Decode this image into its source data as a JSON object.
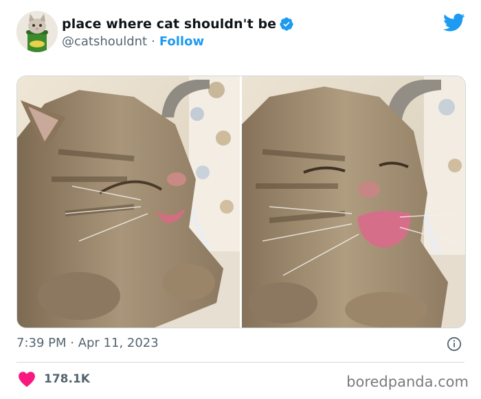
{
  "tweet": {
    "display_name": "place where cat shouldn't be",
    "handle": "@catshouldnt",
    "separator": "·",
    "follow_label": "Follow",
    "timestamp": "7:39 PM · Apr 11, 2023",
    "like_count": "178.1K"
  },
  "watermark": "boredpanda.com",
  "icons": {
    "verified": "verified-badge-icon",
    "platform": "twitter-bird-icon",
    "info": "info-icon",
    "like": "heart-icon"
  },
  "colors": {
    "accent": "#1d9bf0",
    "heart": "#f91880",
    "text_primary": "#0f1419",
    "text_secondary": "#536471",
    "border": "#cfd9de"
  }
}
